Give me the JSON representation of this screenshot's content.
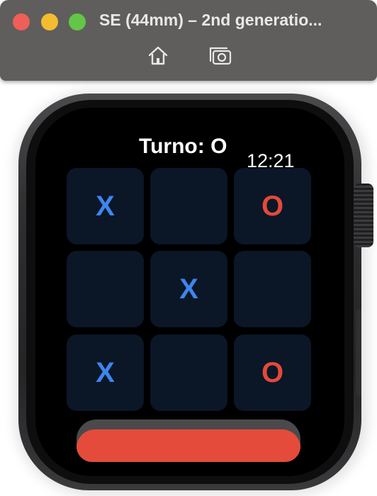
{
  "window": {
    "title": "SE (44mm) – 2nd generatio...",
    "toolbar": {
      "home_icon": "home-icon",
      "screenshot_icon": "camera-icon"
    }
  },
  "watch": {
    "turn_label": "Turno: O",
    "time": "12:21",
    "board": [
      [
        "X",
        "",
        "O"
      ],
      [
        "",
        "X",
        ""
      ],
      [
        "X",
        "",
        "O"
      ]
    ],
    "colors": {
      "x": "#3d86ee",
      "o": "#e34a3a",
      "cell": "#0b1627",
      "action": "#e44b3b"
    }
  }
}
